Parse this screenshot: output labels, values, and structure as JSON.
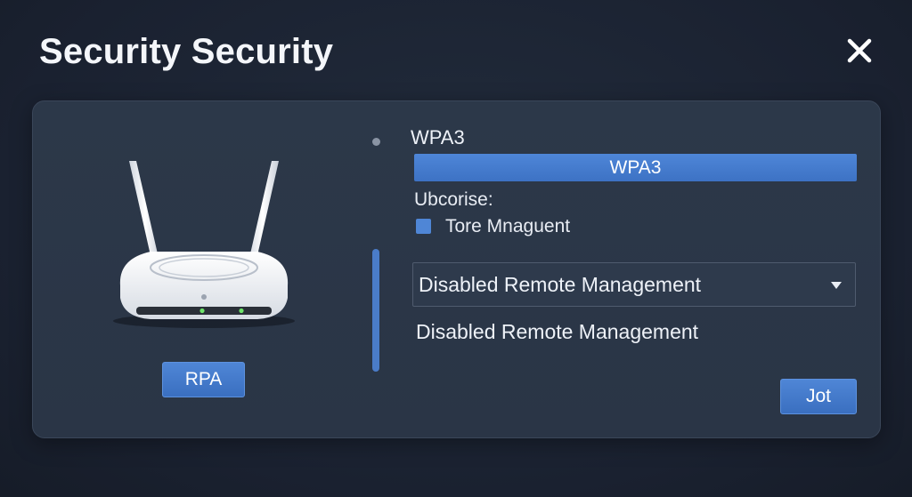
{
  "window": {
    "title": "Security Security",
    "close_icon": "close-icon"
  },
  "router": {
    "icon": "wifi-router-icon",
    "button_label": "RPA"
  },
  "security": {
    "mode_label": "WPA3",
    "mode_value": "WPA3",
    "section_label": "Ubcorise:",
    "checkbox_label": "Tore Mnaguent",
    "checkbox_checked": true,
    "remote_select_value": "Disabled Remote Management",
    "remote_status_text": "Disabled Remote Management",
    "submit_label": "Jot"
  },
  "colors": {
    "accent": "#4a7cc8",
    "background": "#1b2230",
    "panel": "#2b3647"
  }
}
